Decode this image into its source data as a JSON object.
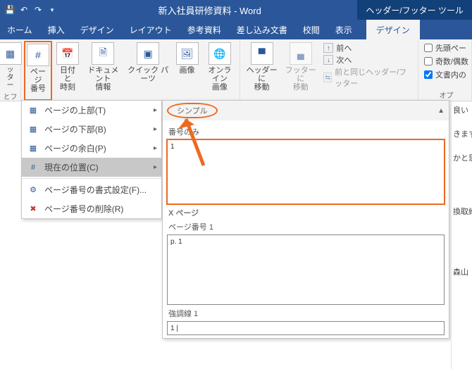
{
  "titlebar": {
    "doc_title": "新入社員研修資料 - Word",
    "context_tool": "ヘッダー/フッター ツール"
  },
  "tabs": {
    "home": "ホーム",
    "insert": "挿入",
    "design": "デザイン",
    "layout": "レイアウト",
    "references": "参考資料",
    "mailings": "差し込み文書",
    "review": "校閲",
    "view": "表示",
    "hf_design": "デザイン"
  },
  "ribbon": {
    "page_number": "ページ\n番号",
    "date_time": "日付と\n時刻",
    "doc_info": "ドキュメント\n情報",
    "quick_parts": "クイック パーツ",
    "pictures": "画像",
    "online_pics": "オンライン\n画像",
    "goto_header": "ヘッダーに\n移動",
    "goto_footer": "フッターに\n移動",
    "nav_prev": "前へ",
    "nav_next": "次へ",
    "link_prev": "前と同じヘッダー/フッター",
    "group_hf_label": "とフッ",
    "opt_first": "先頭ペー",
    "opt_oddeven": "奇数/偶数",
    "opt_showdoc": "文書内の",
    "options_group": "オプ"
  },
  "dropdown": {
    "top": "ページの上部(T)",
    "bottom": "ページの下部(B)",
    "margins": "ページの余白(P)",
    "current": "現在の位置(C)",
    "format": "ページ番号の書式設定(F)...",
    "remove": "ページ番号の削除(R)"
  },
  "gallery": {
    "category": "シンプル",
    "item1_label": "番号のみ",
    "item1_content": "1",
    "x_page": "X ページ",
    "item2_label": "ページ番号 1",
    "item2_content": "p. 1",
    "item3_label": "強調線 1",
    "item3_content": "1 |"
  },
  "doc_edge": {
    "l1": "良い",
    "l2": "きます",
    "l3": "かと思",
    "l4": "換取締",
    "l5": "森山"
  }
}
